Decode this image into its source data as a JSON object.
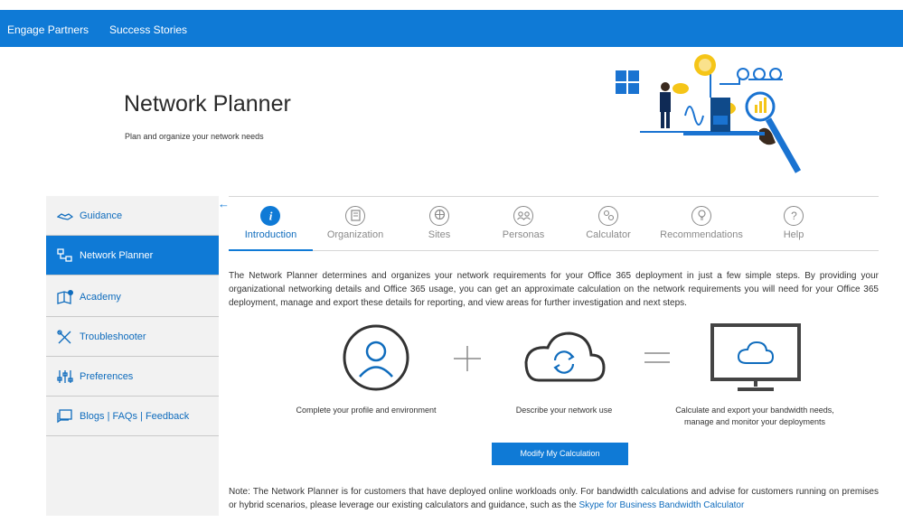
{
  "topnav": {
    "items": [
      "Engage Partners",
      "Success Stories"
    ]
  },
  "hero": {
    "title": "Network Planner",
    "subtitle": "Plan and organize your network needs"
  },
  "sidebar": {
    "items": [
      {
        "label": "Guidance",
        "icon": "handshake-icon"
      },
      {
        "label": "Network Planner",
        "icon": "network-icon",
        "active": true
      },
      {
        "label": "Academy",
        "icon": "book-icon"
      },
      {
        "label": "Troubleshooter",
        "icon": "tools-icon"
      },
      {
        "label": "Preferences",
        "icon": "sliders-icon"
      },
      {
        "label": "Blogs | FAQs | Feedback",
        "icon": "chat-icon"
      }
    ]
  },
  "tabs": [
    {
      "label": "Introduction",
      "icon": "info-icon",
      "active": true
    },
    {
      "label": "Organization",
      "icon": "building-icon"
    },
    {
      "label": "Sites",
      "icon": "globe-icon"
    },
    {
      "label": "Personas",
      "icon": "people-icon"
    },
    {
      "label": "Calculator",
      "icon": "calculator-icon"
    },
    {
      "label": "Recommendations",
      "icon": "lightbulb-icon"
    },
    {
      "label": "Help",
      "icon": "question-icon"
    }
  ],
  "intro": {
    "description": "The Network Planner determines and organizes your network requirements for your Office 365 deployment in just a few simple steps. By providing your organizational networking details and Office 365 usage, you can get an approximate calculation on the network requirements you will need for your Office 365 deployment, manage and export these details for reporting, and view areas for further investigation and next steps.",
    "steps": [
      {
        "label": "Complete your profile and environment",
        "icon": "person-circle-icon"
      },
      {
        "label": "Describe your network use",
        "icon": "cloud-sync-icon"
      },
      {
        "label_line1": "Calculate and export your bandwidth needs,",
        "label_line2": "manage and monitor your deployments",
        "icon": "monitor-cloud-icon"
      }
    ],
    "modify_button": "Modify My Calculation",
    "note": "Note: The Network Planner is for customers that have deployed online workloads only. For bandwidth calculations and advise for customers running on premises or hybrid scenarios, please leverage our existing calculators and guidance, such as the ",
    "note_link": "Skype for Business Bandwidth Calculator"
  },
  "colors": {
    "accent": "#0f7ad6",
    "link": "#0f6cbd"
  }
}
